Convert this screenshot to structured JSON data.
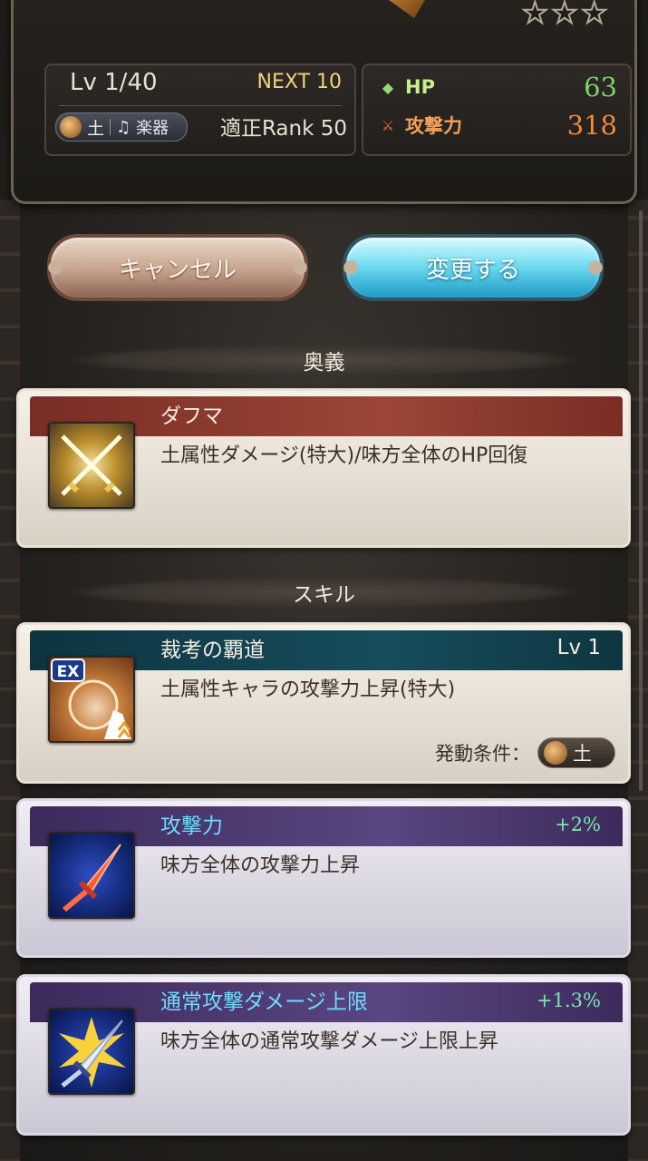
{
  "summon": {
    "stars": 3,
    "level": "Lv 1/40",
    "next": "NEXT 10",
    "element": "土",
    "category": "楽器",
    "rank_required": "適正Rank 50",
    "hp_label": "HP",
    "hp_value": "63",
    "atk_label": "攻撃力",
    "atk_value": "318"
  },
  "buttons": {
    "cancel": "キャンセル",
    "change": "変更する"
  },
  "sections": {
    "ougi": "奥義",
    "skill": "スキル"
  },
  "ougi": {
    "name": "ダフマ",
    "desc": "土属性ダメージ(特大)/味方全体のHP回復"
  },
  "skills": [
    {
      "name": "裁考の覇道",
      "level": "Lv 1",
      "desc": "土属性キャラの攻撃力上昇(特大)",
      "condition_label": "発動条件：",
      "condition_element": "土"
    },
    {
      "name": "攻撃力",
      "bonus": "+2%",
      "desc": "味方全体の攻撃力上昇"
    },
    {
      "name": "通常攻撃ダメージ上限",
      "bonus": "+1.3%",
      "desc": "味方全体の通常攻撃ダメージ上限上昇"
    }
  ],
  "icons": {
    "hp": "green-diamond-icon",
    "atk": "sword-icon",
    "element": "earth-orb-icon",
    "instrument": "lyre-icon"
  },
  "colors": {
    "hp_value": "#7dd36a",
    "atk_value": "#f08a3a",
    "accent_cyan": "#6fdcff"
  }
}
